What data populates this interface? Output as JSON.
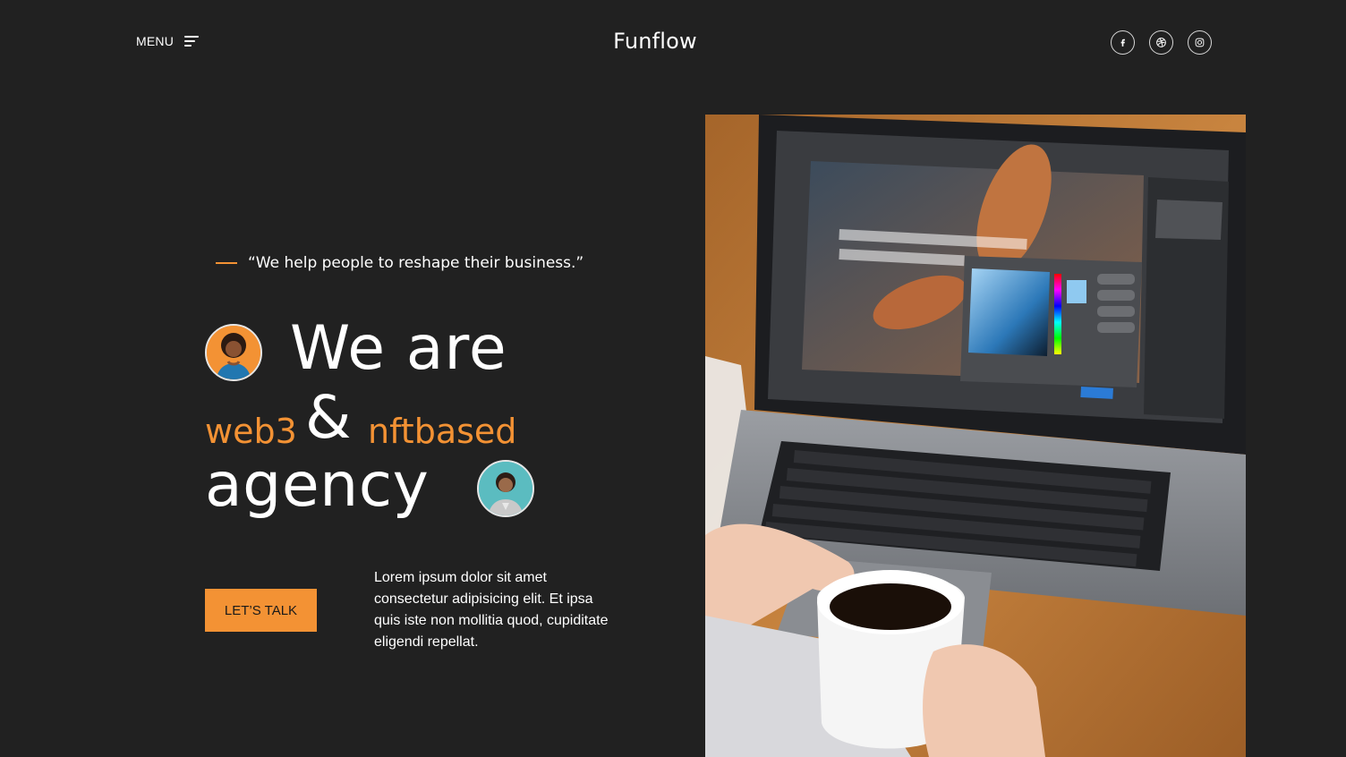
{
  "header": {
    "menu_label": "MENU",
    "logo": "Funflow",
    "socials": [
      {
        "icon": "facebook-icon"
      },
      {
        "icon": "dribbble-icon"
      },
      {
        "icon": "instagram-icon"
      }
    ]
  },
  "hero": {
    "tagline": "“We help people to reshape their business.”",
    "headline": {
      "line1": "We are",
      "accent1": "web3",
      "ampersand": "&",
      "accent2": "nftbased",
      "line3": "agency"
    },
    "cta_label": "LET’S TALK",
    "description": "Lorem ipsum dolor sit amet consectetur adipisicing elit. Et ipsa quis iste non mollitia quod, cupiditate eligendi repellat."
  },
  "colors": {
    "background": "#212121",
    "accent": "#f39234",
    "text": "#ffffff"
  }
}
